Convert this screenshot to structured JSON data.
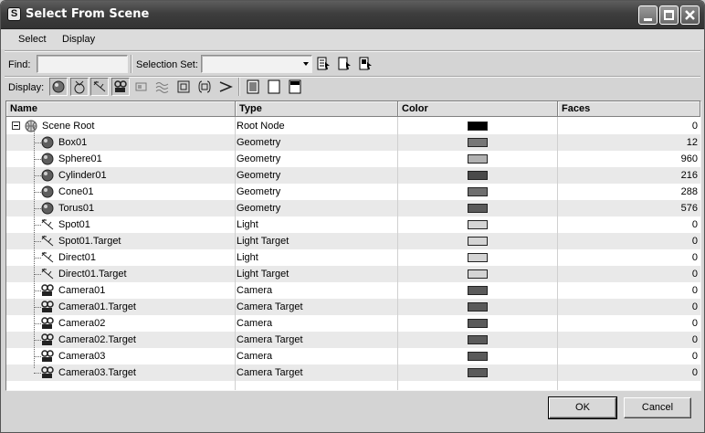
{
  "window": {
    "title": "Select From Scene",
    "app_icon_glyph": "S",
    "controls": [
      "minimize",
      "maximize",
      "close"
    ]
  },
  "menu": {
    "items": [
      "Select",
      "Display"
    ]
  },
  "find": {
    "find_label": "Find:",
    "find_value": "",
    "selection_set_label": "Selection Set:",
    "selection_set_value": ""
  },
  "display": {
    "label": "Display:"
  },
  "table": {
    "columns": [
      "Name",
      "Type",
      "Color",
      "Faces"
    ],
    "rows": [
      {
        "name": "Scene Root",
        "type": "Root Node",
        "color": "#000000",
        "faces": "0",
        "icon": "scene-root"
      },
      {
        "name": "Box01",
        "type": "Geometry",
        "color": "#777777",
        "faces": "12",
        "icon": "geometry"
      },
      {
        "name": "Sphere01",
        "type": "Geometry",
        "color": "#b2b2b2",
        "faces": "960",
        "icon": "geometry"
      },
      {
        "name": "Cylinder01",
        "type": "Geometry",
        "color": "#4a4a4a",
        "faces": "216",
        "icon": "geometry"
      },
      {
        "name": "Cone01",
        "type": "Geometry",
        "color": "#6f6f6f",
        "faces": "288",
        "icon": "geometry"
      },
      {
        "name": "Torus01",
        "type": "Geometry",
        "color": "#5a5a5a",
        "faces": "576",
        "icon": "geometry"
      },
      {
        "name": "Spot01",
        "type": "Light",
        "color": "#d4d4d4",
        "faces": "0",
        "icon": "light"
      },
      {
        "name": "Spot01.Target",
        "type": "Light Target",
        "color": "#d4d4d4",
        "faces": "0",
        "icon": "light"
      },
      {
        "name": "Direct01",
        "type": "Light",
        "color": "#d4d4d4",
        "faces": "0",
        "icon": "light"
      },
      {
        "name": "Direct01.Target",
        "type": "Light Target",
        "color": "#d4d4d4",
        "faces": "0",
        "icon": "light"
      },
      {
        "name": "Camera01",
        "type": "Camera",
        "color": "#5a5a5a",
        "faces": "0",
        "icon": "camera"
      },
      {
        "name": "Camera01.Target",
        "type": "Camera Target",
        "color": "#5a5a5a",
        "faces": "0",
        "icon": "camera"
      },
      {
        "name": "Camera02",
        "type": "Camera",
        "color": "#5a5a5a",
        "faces": "0",
        "icon": "camera"
      },
      {
        "name": "Camera02.Target",
        "type": "Camera Target",
        "color": "#5a5a5a",
        "faces": "0",
        "icon": "camera"
      },
      {
        "name": "Camera03",
        "type": "Camera",
        "color": "#5a5a5a",
        "faces": "0",
        "icon": "camera"
      },
      {
        "name": "Camera03.Target",
        "type": "Camera Target",
        "color": "#5a5a5a",
        "faces": "0",
        "icon": "camera"
      }
    ]
  },
  "buttons": {
    "ok": "OK",
    "cancel": "Cancel"
  }
}
